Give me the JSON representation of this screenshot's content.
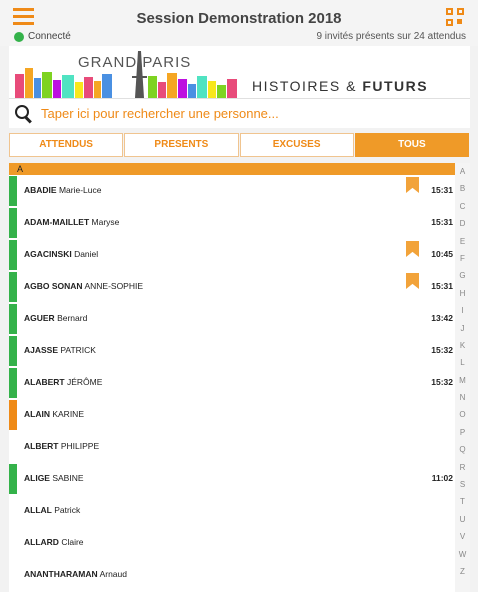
{
  "header": {
    "title": "Session Demonstration 2018",
    "status_label": "Connecté",
    "status_color": "#34b24a",
    "counts_text": "9 invités présents sur 24 attendus",
    "menu_icon": "menu-icon",
    "qr_icon": "qr-code-icon",
    "accent_color": "#ef8a17"
  },
  "banner": {
    "logo_title": "GRAND PARIS",
    "tagline_left": "HISTOIRES & ",
    "tagline_right": "FUTURS"
  },
  "search": {
    "placeholder": "Taper ici pour rechercher une personne...",
    "value": ""
  },
  "tabs": [
    {
      "label": "ATTENDUS",
      "active": false
    },
    {
      "label": "PRESENTS",
      "active": false
    },
    {
      "label": "EXCUSES",
      "active": false
    },
    {
      "label": "TOUS",
      "active": true
    }
  ],
  "section": {
    "letter": "A"
  },
  "rows": [
    {
      "last": "ABADIE",
      "first": "Marie-Luce",
      "status": "present",
      "time": "15:31",
      "flag": true
    },
    {
      "last": "ADAM-MAILLET",
      "first": "Maryse",
      "status": "present",
      "time": "15:31",
      "flag": false
    },
    {
      "last": "AGACINSKI",
      "first": "Daniel",
      "status": "present",
      "time": "10:45",
      "flag": true
    },
    {
      "last": "AGBO SONAN",
      "first": "ANNE-SOPHIE",
      "status": "present",
      "time": "15:31",
      "flag": true
    },
    {
      "last": "AGUER",
      "first": "Bernard",
      "status": "present",
      "time": "13:42",
      "flag": false
    },
    {
      "last": "AJASSE",
      "first": "PATRICK",
      "status": "present",
      "time": "15:32",
      "flag": false
    },
    {
      "last": "ALABERT",
      "first": "JÉRÔME",
      "status": "present",
      "time": "15:32",
      "flag": false
    },
    {
      "last": "ALAIN",
      "first": "KARINE",
      "status": "excused",
      "time": "",
      "flag": false
    },
    {
      "last": "ALBERT",
      "first": "PHILIPPE",
      "status": "none",
      "time": "",
      "flag": false
    },
    {
      "last": "ALIGE",
      "first": "SABINE",
      "status": "present",
      "time": "11:02",
      "flag": false
    },
    {
      "last": "ALLAL",
      "first": "Patrick",
      "status": "none",
      "time": "",
      "flag": false
    },
    {
      "last": "ALLARD",
      "first": "Claire",
      "status": "none",
      "time": "",
      "flag": false
    },
    {
      "last": "ANANTHARAMAN",
      "first": "Arnaud",
      "status": "none",
      "time": "",
      "flag": false
    }
  ],
  "status_colors": {
    "present": "#34b24a",
    "excused": "#ef8a17",
    "none": "transparent"
  },
  "alphabet": [
    "A",
    "B",
    "C",
    "D",
    "E",
    "F",
    "G",
    "H",
    "I",
    "J",
    "K",
    "L",
    "M",
    "N",
    "O",
    "P",
    "Q",
    "R",
    "S",
    "T",
    "U",
    "V",
    "W",
    "Z"
  ]
}
